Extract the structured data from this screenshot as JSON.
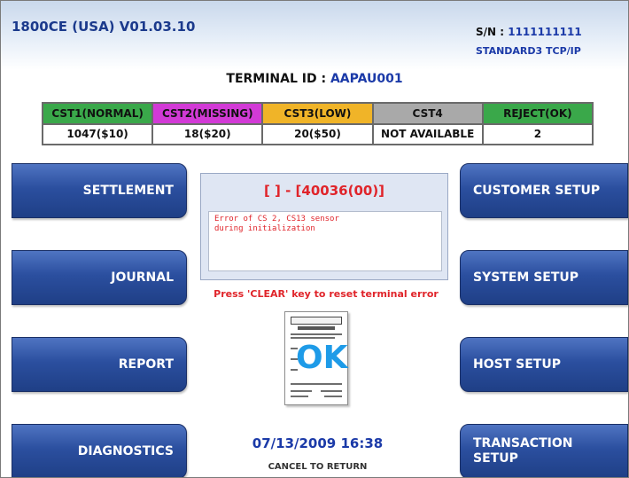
{
  "header": {
    "version": "1800CE (USA) V01.03.10",
    "sn_label": "S/N :",
    "sn_value": "1111111111",
    "protocol": "STANDARD3 TCP/IP",
    "terminal_id_label": "TERMINAL ID :",
    "terminal_id_value": "AAPAU001"
  },
  "cassettes": [
    {
      "label": "CST1(NORMAL)",
      "value": "1047($10)",
      "color": "#3aa84a"
    },
    {
      "label": "CST2(MISSING)",
      "value": "18($20)",
      "color": "#d23ad6"
    },
    {
      "label": "CST3(LOW)",
      "value": "20($50)",
      "color": "#f0b428"
    },
    {
      "label": "CST4",
      "value": "NOT AVAILABLE",
      "color": "#a9a9a9"
    },
    {
      "label": "REJECT(OK)",
      "value": "2",
      "color": "#3aa84a"
    }
  ],
  "left_buttons": [
    {
      "label": "SETTLEMENT"
    },
    {
      "label": "JOURNAL"
    },
    {
      "label": "REPORT"
    },
    {
      "label": "DIAGNOSTICS"
    }
  ],
  "right_buttons": [
    {
      "label": "CUSTOMER SETUP"
    },
    {
      "label": "SYSTEM SETUP"
    },
    {
      "label": "HOST SETUP"
    },
    {
      "label_line1": "TRANSACTION",
      "label_line2": "SETUP"
    }
  ],
  "error": {
    "code": "[ ] - [40036(00)]",
    "message_line1": "Error of CS 2, CS13 sensor",
    "message_line2": "during initialization",
    "reset_instruction": "Press 'CLEAR' key to reset terminal error"
  },
  "receipt": {
    "ok_text": "OK",
    "ok_color": "#1e9be8"
  },
  "footer": {
    "datetime": "07/13/2009  16:38",
    "cancel_text": "CANCEL TO RETURN"
  },
  "colors": {
    "button_blue": "#2b4f9f",
    "accent_blue": "#1b3aa8",
    "error_red": "#e0242a"
  }
}
